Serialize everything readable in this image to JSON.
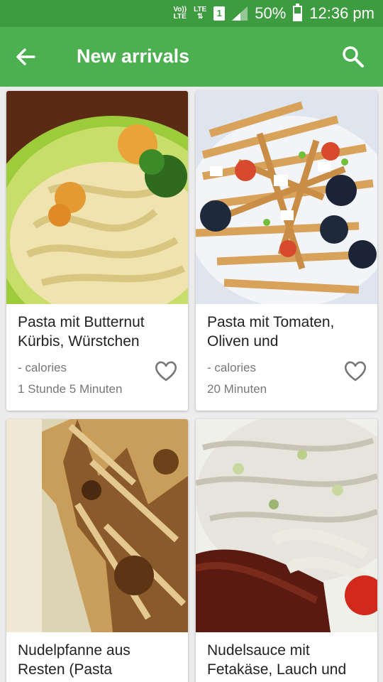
{
  "status_bar": {
    "volte_line1": "Vo))",
    "volte_line2": "LTE",
    "lte": "LTE",
    "sim_slot": "1",
    "battery": "50%",
    "time": "12:36 pm",
    "battery_level": 0.5
  },
  "toolbar": {
    "title": "New arrivals",
    "back_icon": "arrow-left-icon",
    "search_icon": "search-icon"
  },
  "colors": {
    "status_bar": "#3e9c40",
    "toolbar": "#4caf50",
    "background": "#ececec"
  },
  "recipes": [
    {
      "title": "Pasta mit Butternut Kürbis, Würstchen",
      "calories": "- calories",
      "time": "1 Stunde 5 Minuten"
    },
    {
      "title": "Pasta mit Tomaten, Oliven und",
      "calories": "- calories",
      "time": "20 Minuten"
    },
    {
      "title": "Nudelpfanne aus Resten (Pasta",
      "calories": "",
      "time": ""
    },
    {
      "title": "Nudelsauce mit Fetakäse, Lauch und",
      "calories": "",
      "time": ""
    }
  ]
}
